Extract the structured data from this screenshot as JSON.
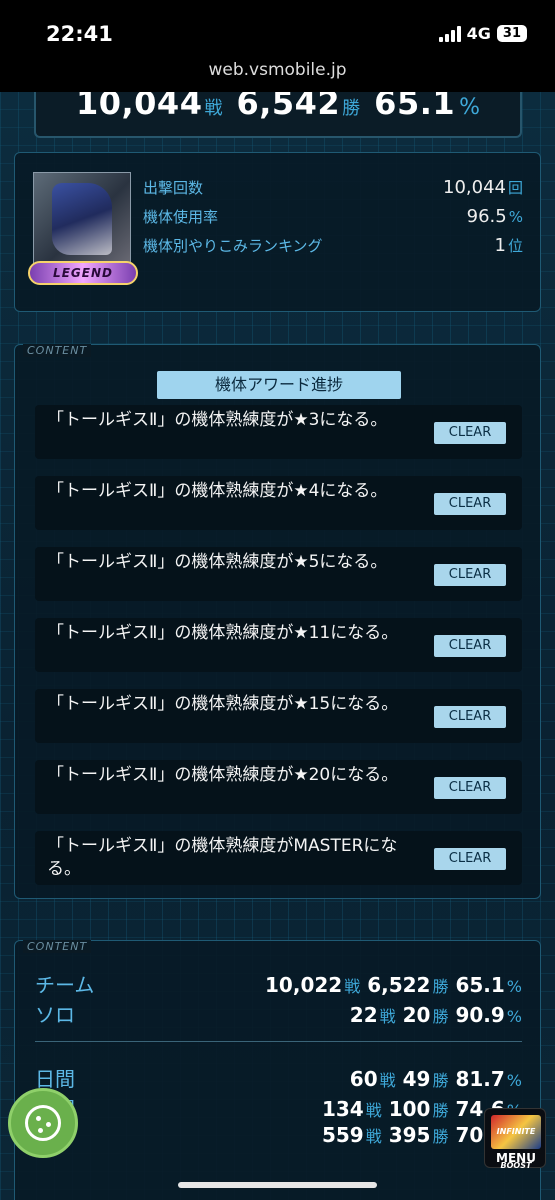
{
  "status_bar": {
    "time": "22:41",
    "network": "4G",
    "battery": "31",
    "url": "web.vsmobile.jp"
  },
  "summary": {
    "battles": "10,044",
    "battles_unit": "戦",
    "wins": "6,542",
    "wins_unit": "勝",
    "rate": "65.1",
    "rate_unit": "%"
  },
  "unit_info": {
    "badge": "LEGEND",
    "rows": [
      {
        "label": "出撃回数",
        "value": "10,044",
        "unit": "回"
      },
      {
        "label": "機体使用率",
        "value": "96.5",
        "unit": "%"
      },
      {
        "label": "機体別やりこみランキング",
        "value": "1",
        "unit": "位"
      }
    ]
  },
  "content_tag": "CONTENT",
  "awards": {
    "title": "機体アワード進捗",
    "items": [
      {
        "text": "「トールギスⅡ」の機体熟練度が★3になる。",
        "button": "CLEAR"
      },
      {
        "text": "「トールギスⅡ」の機体熟練度が★4になる。",
        "button": "CLEAR"
      },
      {
        "text": "「トールギスⅡ」の機体熟練度が★5になる。",
        "button": "CLEAR"
      },
      {
        "text": "「トールギスⅡ」の機体熟練度が★11になる。",
        "button": "CLEAR"
      },
      {
        "text": "「トールギスⅡ」の機体熟練度が★15になる。",
        "button": "CLEAR"
      },
      {
        "text": "「トールギスⅡ」の機体熟練度が★20になる。",
        "button": "CLEAR"
      },
      {
        "text": "「トールギスⅡ」の機体熟練度がMASTERになる。",
        "button": "CLEAR"
      }
    ]
  },
  "records": {
    "units": {
      "battle": "戦",
      "win": "勝",
      "percent": "%"
    },
    "mode_rows": [
      {
        "label": "チーム",
        "battles": "10,022",
        "wins": "6,522",
        "rate": "65.1"
      },
      {
        "label": "ソロ",
        "battles": "22",
        "wins": "20",
        "rate": "90.9"
      }
    ],
    "period_rows": [
      {
        "label": "日間",
        "battles": "60",
        "wins": "49",
        "rate": "81.7"
      },
      {
        "label": "週間",
        "battles": "134",
        "wins": "100",
        "rate": "74.6"
      },
      {
        "label": "",
        "battles": "559",
        "wins": "395",
        "rate": "70.7"
      }
    ]
  },
  "menu": {
    "logo_text": "INFINITE BOOST",
    "label": "MENU"
  }
}
